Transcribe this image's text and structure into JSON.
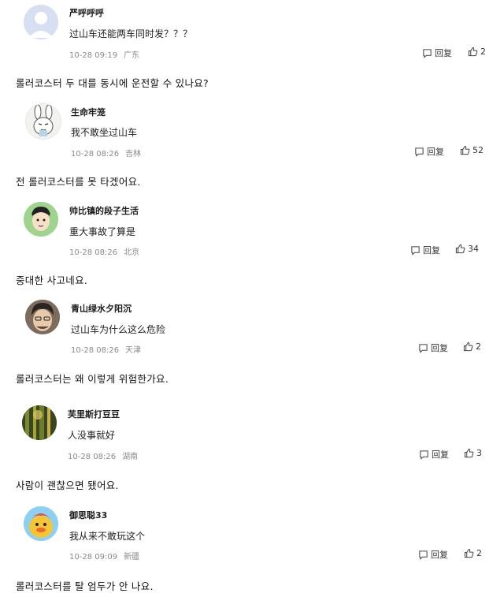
{
  "comments": [
    {
      "username": "严呼呼呼",
      "content": "过山车还能两车同时发？？？",
      "date": "10-28 09:19",
      "location": "广东",
      "reply": "回复",
      "likes": "2",
      "translation": "롤러코스터 두 대를 동시에 운전할 수 있나요?"
    },
    {
      "username": "生命牢笼",
      "content": "我不敢坐过山车",
      "date": "10-28 08:26",
      "location": "吉林",
      "reply": "回复",
      "likes": "52",
      "translation": "전 롤러코스터를 못 타겠어요."
    },
    {
      "username": "帅比镇的段子生活",
      "content": "重大事故了算是",
      "date": "10-28 08:26",
      "location": "北京",
      "reply": "回复",
      "likes": "34",
      "translation": "중대한 사고네요."
    },
    {
      "username": "青山绿水夕阳沉",
      "content": "过山车为什么这么危险",
      "date": "10-28 08:26",
      "location": "天津",
      "reply": "回复",
      "likes": "2",
      "translation": "롤러코스터는 왜 이렇게 위험한가요."
    },
    {
      "username": "芙里斯打豆豆",
      "content": "人没事就好",
      "date": "10-28 08:26",
      "location": "湖南",
      "reply": "回复",
      "likes": "3",
      "translation": "사람이 괜찮으면 됐어요."
    },
    {
      "username": "御思聪33",
      "content": "我从来不敢玩这个",
      "date": "10-28 09:09",
      "location": "新疆",
      "reply": "回复",
      "likes": "2",
      "translation": "롤러코스터를 탈 엄두가 안 나요."
    }
  ]
}
